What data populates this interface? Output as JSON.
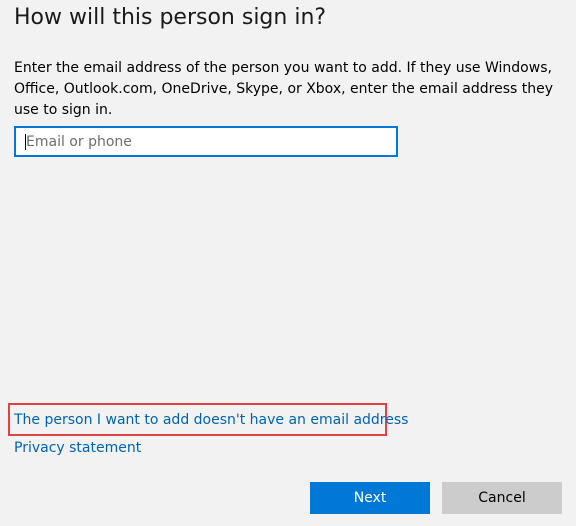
{
  "dialog": {
    "title": "How will this person sign in?",
    "description": "Enter the email address of the person you want to add. If they use Windows, Office, Outlook.com, OneDrive, Skype, or Xbox, enter the email address they use to sign in.",
    "email_input": {
      "value": "",
      "placeholder": "Email or phone"
    },
    "links": {
      "no_email": "The person I want to add doesn't have an email address",
      "privacy": "Privacy statement"
    },
    "buttons": {
      "next": "Next",
      "cancel": "Cancel"
    }
  },
  "colors": {
    "background": "#f2f2f2",
    "accent": "#0078d7",
    "link": "#0063b1",
    "highlight_box": "#e04343",
    "cancel_button": "#cccccc"
  }
}
